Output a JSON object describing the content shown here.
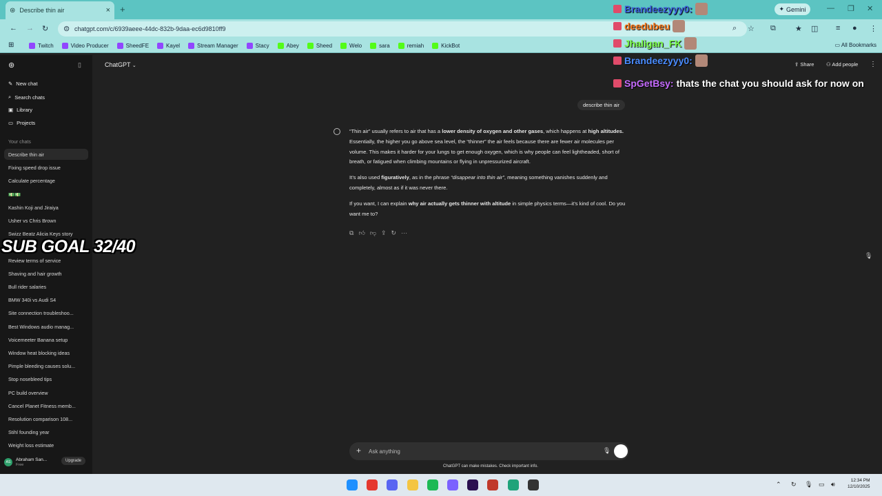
{
  "browser": {
    "tab_title": "Describe thin air",
    "tab_close": "×",
    "new_tab": "+",
    "gemini_label": "Gemini",
    "url": "chatgpt.com/c/6939aeee-44dc-832b-9daa-ec6d9810ff9",
    "bookmarks": [
      "Twitch",
      "Video Producer",
      "SheedFE",
      "Kayel",
      "Stream Manager",
      "Stacy",
      "Abey",
      "Sheed",
      "Welo",
      "sara",
      "remiah",
      "KickBot"
    ],
    "bookmark_colors": [
      "#9146ff",
      "#9146ff",
      "#9146ff",
      "#9146ff",
      "#9146ff",
      "#9146ff",
      "#53fc18",
      "#53fc18",
      "#53fc18",
      "#53fc18",
      "#53fc18",
      "#53fc18"
    ],
    "all_bookmarks": "All Bookmarks"
  },
  "sidebar": {
    "new_chat": "New chat",
    "search_chats": "Search chats",
    "library": "Library",
    "projects": "Projects",
    "your_chats": "Your chats",
    "chats": [
      "Describe thin air",
      "Fixing speed drop issue",
      "Calculate percentage",
      "💵💵",
      "Kashin Koji and Jiraiya",
      "Usher vs Chris Brown",
      "Swizz Beatz Alicia Keys story",
      "",
      "Review terms of service",
      "Shaving and hair growth",
      "Bull rider salaries",
      "BMW 340i vs Audi S4",
      "Site connection troubleshoo...",
      "Best Windows audio manag...",
      "Voicemeeter Banana setup",
      "Window heat blocking ideas",
      "Pimple bleeding causes solu...",
      "Stop nosebleed tips",
      "PC build overview",
      "Cancel Planet Fitness memb...",
      "Resolution comparison 108...",
      "Stihl founding year",
      "Weight loss estimate"
    ],
    "user_name": "Abraham San...",
    "user_plan": "Free",
    "user_initials": "AS",
    "upgrade": "Upgrade"
  },
  "main": {
    "model": "ChatGPT",
    "share": "Share",
    "add_people": "Add people",
    "user_message": "describe thin air",
    "answer": {
      "p1": [
        {
          "t": "“Thin air” usually refers to air that has a ",
          "b": false
        },
        {
          "t": "lower density of oxygen and other gases",
          "b": true
        },
        {
          "t": ", which happens at ",
          "b": false
        },
        {
          "t": "high altitudes.",
          "b": true
        },
        {
          "t": " Essentially, the higher you go above sea level, the “thinner” the air feels because there are fewer air molecules per volume. This makes it harder for your lungs to get enough oxygen, which is why people can feel lightheaded, short of breath, or fatigued when climbing mountains or flying in unpressurized aircraft.",
          "b": false
        }
      ],
      "p2": [
        {
          "t": "It’s also used ",
          "b": false
        },
        {
          "t": "figuratively",
          "b": true
        },
        {
          "t": ", as in the phrase ",
          "b": false
        },
        {
          "t": "“disappear into thin air”",
          "i": true
        },
        {
          "t": ", meaning something vanishes suddenly and completely, almost as if it was never there.",
          "b": false
        }
      ],
      "p3": [
        {
          "t": "If you want, I can explain ",
          "b": false
        },
        {
          "t": "why air actually gets thinner with altitude",
          "b": true
        },
        {
          "t": " in simple physics terms—it’s kind of cool. Do you want me to?",
          "b": false
        }
      ]
    },
    "composer_placeholder": "Ask anything",
    "disclaimer": "ChatGPT can make mistakes. Check important info."
  },
  "overlay": {
    "sub_goal": "SUB GOAL 32/40",
    "chat": [
      {
        "user": "Brandeezyyy0:",
        "msg": "",
        "color": "#3a5bd9"
      },
      {
        "user": "deedubeu",
        "msg": "",
        "color": "#ff7a1a"
      },
      {
        "user": "Jhaligan_FK",
        "msg": "",
        "color": "#7cff4a"
      },
      {
        "user": "Brandeezyyy0:",
        "msg": "",
        "color": "#4a8cff"
      },
      {
        "user": "SpGetBsy:",
        "msg": "thats the chat you should ask for now on",
        "color": "#c66bff"
      }
    ]
  },
  "taskbar": {
    "time": "12:34 PM",
    "date": "12/10/2025",
    "apps": [
      "start",
      "chrome",
      "discord",
      "explorer",
      "spotify",
      "chatgpt",
      "premiere",
      "vegas",
      "other-app",
      "obs"
    ],
    "app_colors": [
      "#1e90ff",
      "#e5382f",
      "#5865f2",
      "#f4c542",
      "#1db954",
      "#7b61ff",
      "#2a1050",
      "#c0392b",
      "#1fa37a",
      "#333333"
    ]
  }
}
